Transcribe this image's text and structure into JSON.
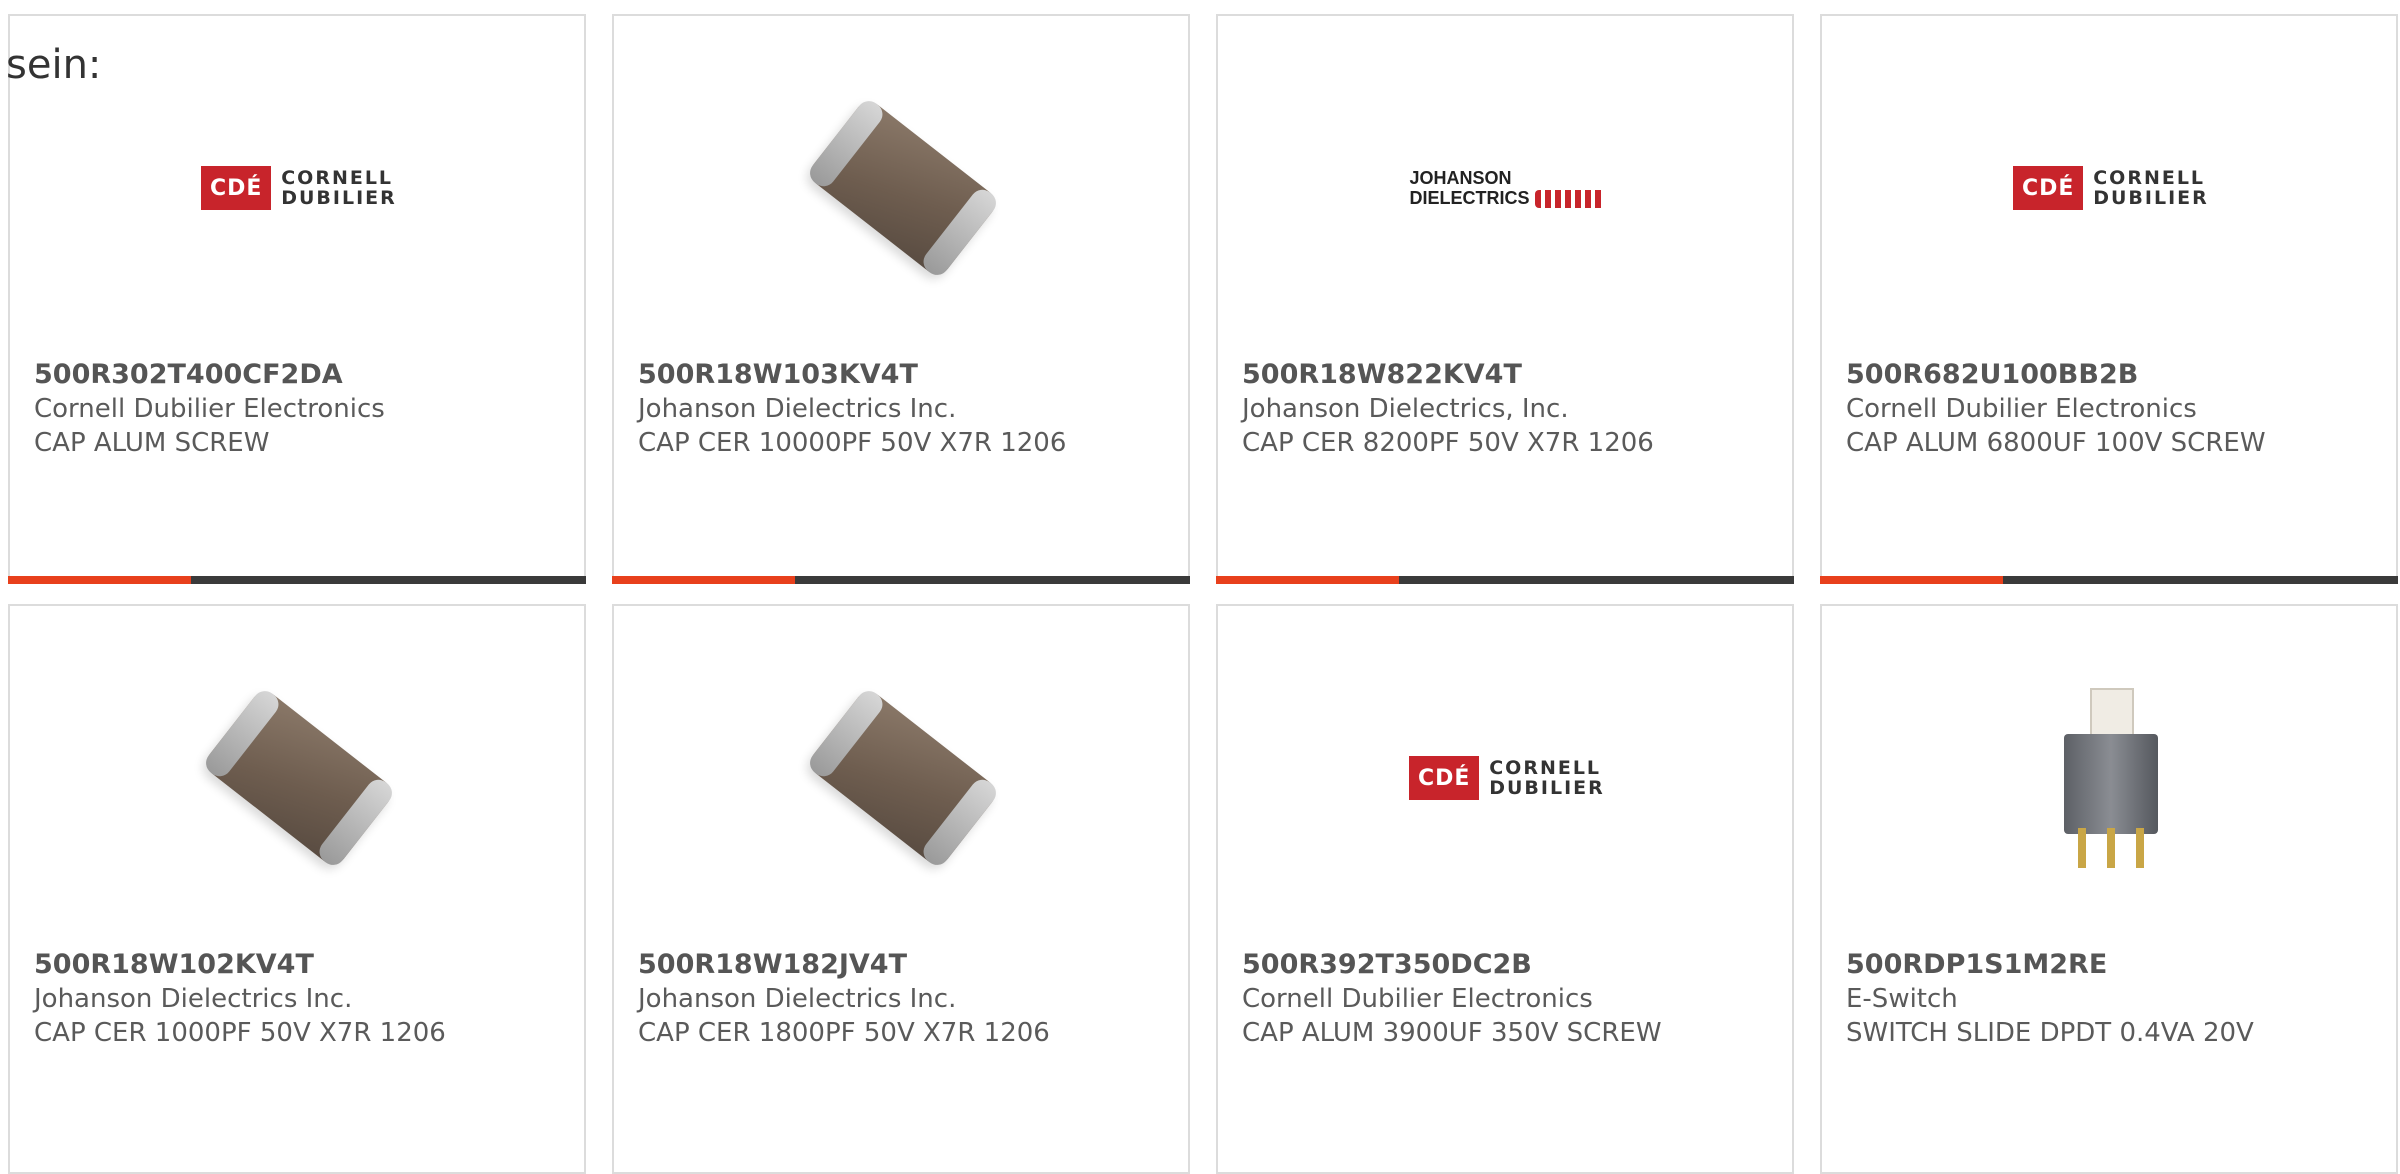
{
  "intro_text": "sein:",
  "accent_color": "#e8401c",
  "products": [
    {
      "part_number": "500R302T400CF2DA",
      "manufacturer": "Cornell Dubilier Electronics",
      "description": "CAP ALUM SCREW",
      "image": "cornell-dubilier-logo"
    },
    {
      "part_number": "500R18W103KV4T",
      "manufacturer": "Johanson Dielectrics Inc.",
      "description": "CAP CER 10000PF 50V X7R 1206",
      "image": "ceramic-chip-capacitor"
    },
    {
      "part_number": "500R18W822KV4T",
      "manufacturer": "Johanson Dielectrics, Inc.",
      "description": "CAP CER 8200PF 50V X7R 1206",
      "image": "johanson-dielectrics-logo"
    },
    {
      "part_number": "500R682U100BB2B",
      "manufacturer": "Cornell Dubilier Electronics",
      "description": "CAP ALUM 6800UF 100V SCREW",
      "image": "cornell-dubilier-logo"
    },
    {
      "part_number": "500R18W102KV4T",
      "manufacturer": "Johanson Dielectrics Inc.",
      "description": "CAP CER 1000PF 50V X7R 1206",
      "image": "ceramic-chip-capacitor"
    },
    {
      "part_number": "500R18W182JV4T",
      "manufacturer": "Johanson Dielectrics Inc.",
      "description": "CAP CER 1800PF 50V X7R 1206",
      "image": "ceramic-chip-capacitor"
    },
    {
      "part_number": "500R392T350DC2B",
      "manufacturer": "Cornell Dubilier Electronics",
      "description": "CAP ALUM 3900UF 350V SCREW",
      "image": "cornell-dubilier-logo"
    },
    {
      "part_number": "500RDP1S1M2RE",
      "manufacturer": "E-Switch",
      "description": "SWITCH SLIDE DPDT 0.4VA 20V",
      "image": "slide-switch"
    }
  ],
  "logos": {
    "cde_mark": "CDÉ",
    "cde_line1": "CORNELL",
    "cde_line2": "DUBILIER",
    "johanson_line1": "JOHANSON",
    "johanson_line2": "DIELECTRICS"
  }
}
